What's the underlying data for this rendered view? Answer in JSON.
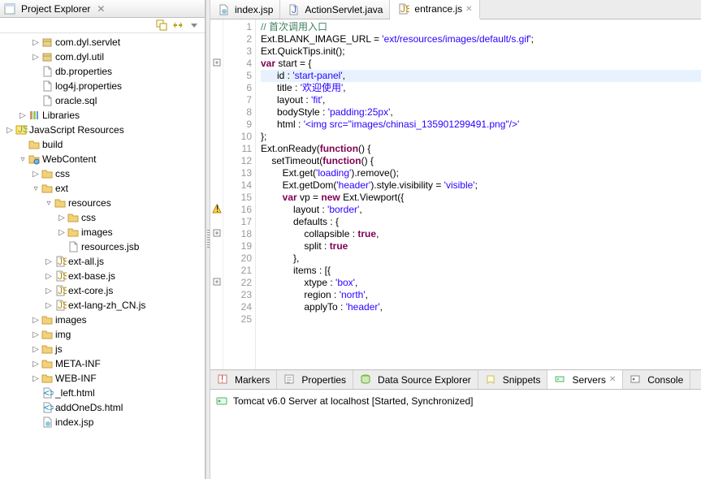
{
  "projectExplorer": {
    "title": "Project Explorer",
    "tree": [
      {
        "depth": 2,
        "tw": "▷",
        "icon": "pkg",
        "label": "com.dyl.servlet"
      },
      {
        "depth": 2,
        "tw": "▷",
        "icon": "pkg",
        "label": "com.dyl.util"
      },
      {
        "depth": 2,
        "tw": "",
        "icon": "file",
        "label": "db.properties"
      },
      {
        "depth": 2,
        "tw": "",
        "icon": "file",
        "label": "log4j.properties"
      },
      {
        "depth": 2,
        "tw": "",
        "icon": "file",
        "label": "oracle.sql"
      },
      {
        "depth": 1,
        "tw": "▷",
        "icon": "lib",
        "label": "Libraries"
      },
      {
        "depth": 0,
        "tw": "▷",
        "icon": "jslib",
        "label": "JavaScript Resources"
      },
      {
        "depth": 1,
        "tw": "",
        "icon": "folder",
        "label": "build"
      },
      {
        "depth": 1,
        "tw": "▿",
        "icon": "webfolder",
        "label": "WebContent"
      },
      {
        "depth": 2,
        "tw": "▷",
        "icon": "folder",
        "label": "css"
      },
      {
        "depth": 2,
        "tw": "▿",
        "icon": "folder",
        "label": "ext"
      },
      {
        "depth": 3,
        "tw": "▿",
        "icon": "folder",
        "label": "resources"
      },
      {
        "depth": 4,
        "tw": "▷",
        "icon": "folder",
        "label": "css"
      },
      {
        "depth": 4,
        "tw": "▷",
        "icon": "folder",
        "label": "images"
      },
      {
        "depth": 4,
        "tw": "",
        "icon": "file",
        "label": "resources.jsb"
      },
      {
        "depth": 3,
        "tw": "▷",
        "icon": "js",
        "label": "ext-all.js"
      },
      {
        "depth": 3,
        "tw": "▷",
        "icon": "js",
        "label": "ext-base.js"
      },
      {
        "depth": 3,
        "tw": "▷",
        "icon": "js",
        "label": "ext-core.js"
      },
      {
        "depth": 3,
        "tw": "▷",
        "icon": "js",
        "label": "ext-lang-zh_CN.js"
      },
      {
        "depth": 2,
        "tw": "▷",
        "icon": "folder",
        "label": "images"
      },
      {
        "depth": 2,
        "tw": "▷",
        "icon": "folder",
        "label": "img"
      },
      {
        "depth": 2,
        "tw": "▷",
        "icon": "folder",
        "label": "js"
      },
      {
        "depth": 2,
        "tw": "▷",
        "icon": "folder",
        "label": "META-INF"
      },
      {
        "depth": 2,
        "tw": "▷",
        "icon": "folder",
        "label": "WEB-INF"
      },
      {
        "depth": 2,
        "tw": "",
        "icon": "html",
        "label": "_left.html"
      },
      {
        "depth": 2,
        "tw": "",
        "icon": "html",
        "label": "addOneDs.html"
      },
      {
        "depth": 2,
        "tw": "",
        "icon": "jsp",
        "label": "index.jsp"
      }
    ]
  },
  "editorTabs": [
    {
      "icon": "jsp",
      "label": "index.jsp",
      "active": false
    },
    {
      "icon": "java",
      "label": "ActionServlet.java",
      "active": false
    },
    {
      "icon": "js",
      "label": "entrance.js",
      "active": true
    }
  ],
  "code": {
    "lines": [
      {
        "n": 1,
        "t": "comment",
        "text": "// 首次调用入口"
      },
      {
        "n": 2,
        "t": "code",
        "text": "Ext.BLANK_IMAGE_URL = 'ext/resources/images/default/s.gif';"
      },
      {
        "n": 3,
        "t": "code",
        "text": "Ext.QuickTips.init();"
      },
      {
        "n": 4,
        "t": "code",
        "fold": true,
        "text": "var start = {"
      },
      {
        "n": 5,
        "t": "code",
        "hl": true,
        "text": "      id : 'start-panel',"
      },
      {
        "n": 6,
        "t": "code",
        "text": "      title : '欢迎使用',"
      },
      {
        "n": 7,
        "t": "code",
        "text": "      layout : 'fit',"
      },
      {
        "n": 8,
        "t": "code",
        "text": "      bodyStyle : 'padding:25px',"
      },
      {
        "n": 9,
        "t": "code",
        "text": "      html : '<img src=\"images/chinasi_135901299491.png\"/>'"
      },
      {
        "n": 10,
        "t": "code",
        "text": "};"
      },
      {
        "n": 11,
        "t": "blank",
        "text": ""
      },
      {
        "n": 12,
        "t": "code",
        "text": "Ext.onReady(function() {"
      },
      {
        "n": 13,
        "t": "code",
        "text": "    setTimeout(function() {"
      },
      {
        "n": 14,
        "t": "code",
        "text": "        Ext.get('loading').remove();"
      },
      {
        "n": 15,
        "t": "code",
        "text": "        Ext.getDom('header').style.visibility = 'visible';"
      },
      {
        "n": 16,
        "t": "code",
        "warn": true,
        "text": "        var vp = new Ext.Viewport({"
      },
      {
        "n": 17,
        "t": "code",
        "text": "            layout : 'border',"
      },
      {
        "n": 18,
        "t": "code",
        "fold": true,
        "text": "            defaults : {"
      },
      {
        "n": 19,
        "t": "code",
        "text": "                collapsible : true,"
      },
      {
        "n": 20,
        "t": "code",
        "text": "                split : true"
      },
      {
        "n": 21,
        "t": "code",
        "text": "            },"
      },
      {
        "n": 22,
        "t": "code",
        "fold": true,
        "text": "            items : [{"
      },
      {
        "n": 23,
        "t": "code",
        "text": "                xtype : 'box',"
      },
      {
        "n": 24,
        "t": "code",
        "text": "                region : 'north',"
      },
      {
        "n": 25,
        "t": "code",
        "text": "                applyTo : 'header',"
      }
    ]
  },
  "bottomTabs": [
    {
      "icon": "markers",
      "label": "Markers",
      "active": false
    },
    {
      "icon": "props",
      "label": "Properties",
      "active": false
    },
    {
      "icon": "dse",
      "label": "Data Source Explorer",
      "active": false
    },
    {
      "icon": "snip",
      "label": "Snippets",
      "active": false
    },
    {
      "icon": "servers",
      "label": "Servers",
      "active": true,
      "closable": true
    },
    {
      "icon": "console",
      "label": "Console",
      "active": false
    }
  ],
  "server": {
    "label": "Tomcat v6.0 Server at localhost  [Started, Synchronized]"
  }
}
